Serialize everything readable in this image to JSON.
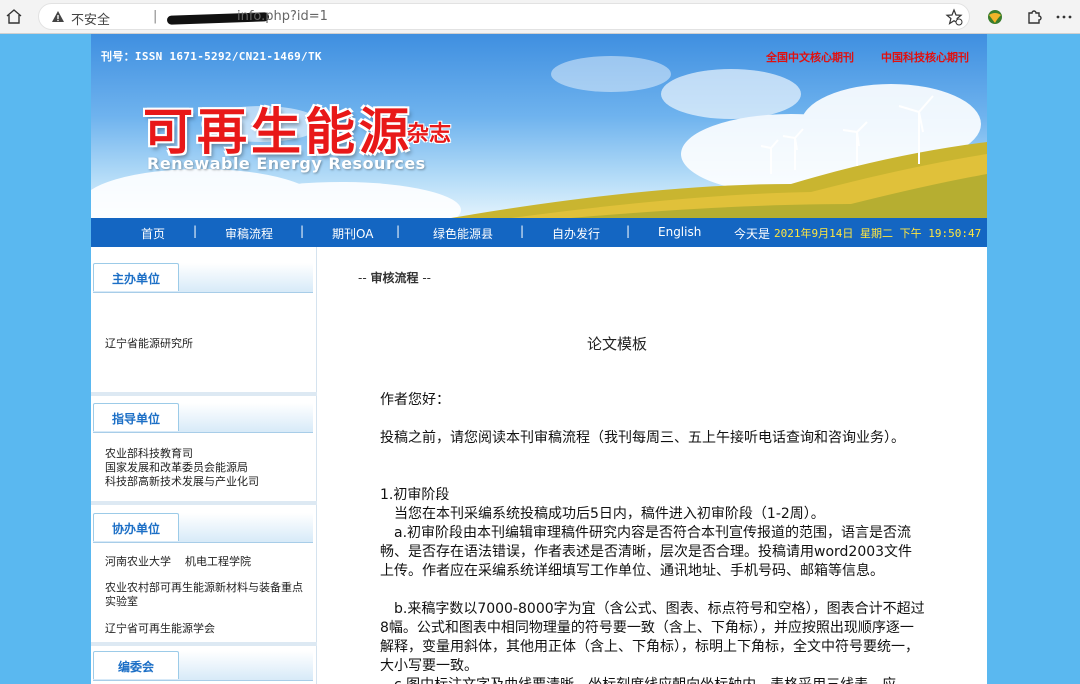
{
  "browser": {
    "security_label": "不安全",
    "separator": "|",
    "url": "info.php?id=1"
  },
  "banner": {
    "issn": "刊号：ISSN 1671-5292/CN21-1469/TK",
    "core_badges": [
      "全国中文核心期刊",
      "中国科技核心期刊"
    ],
    "title": "可再生能源",
    "title_suffix": "杂志",
    "english_title": "Renewable Energy Resources"
  },
  "nav": {
    "items": [
      "首页",
      "审稿流程",
      "期刊OA",
      "绿色能源县",
      "自办发行",
      "English"
    ],
    "separator": "|",
    "today_label": "今天是",
    "date": "2021年9月14日 星期二 下午 19:50:47"
  },
  "sidebar": {
    "sections": [
      {
        "title": "主办单位",
        "lines": [
          "辽宁省能源研究所"
        ]
      },
      {
        "title": "指导单位",
        "lines": [
          "农业部科技教育司",
          "国家发展和改革委员会能源局",
          "科技部高新技术发展与产业化司"
        ]
      },
      {
        "title": "协办单位",
        "lines": [
          "河南农业大学    机电工程学院",
          "农业农村部可再生能源新材料与装备重点实验室",
          "辽宁省可再生能源学会"
        ]
      },
      {
        "title": "编委会",
        "lines": []
      }
    ]
  },
  "content": {
    "breadcrumb_prefix": "-- ",
    "breadcrumb": "审核流程",
    "breadcrumb_suffix": " --",
    "doc_title": "论文模板",
    "paragraphs": [
      "作者您好：",
      "投稿之前，请您阅读本刊审稿流程（我刊每周三、五上午接听电话查询和咨询业务）。",
      "1.初审阶段",
      "　当您在本刊采编系统投稿成功后5日内，稿件进入初审阶段（1-2周）。",
      "　a.初审阶段由本刊编辑审理稿件研究内容是否符合本刊宣传报道的范围，语言是否流畅、是否存在语法错误，作者表述是否清晰，层次是否合理。投稿请用word2003文件上传。作者应在采编系统详细填写工作单位、通讯地址、手机号码、邮箱等信息。",
      "　b.来稿字数以7000-8000字为宜（含公式、图表、标点符号和空格），图表合计不超过8幅。公式和图表中相同物理量的符号要一致（含上、下角标），并应按照出现顺序逐一解释，变量用斜体，其他用正体（含上、下角标），标明上下角标，全文中符号要统一，大小写要一致。",
      "　c.图中标注文字及曲线要清晰，坐标刻度线应朝向坐标轴内，表格采用三线表，应"
    ]
  }
}
